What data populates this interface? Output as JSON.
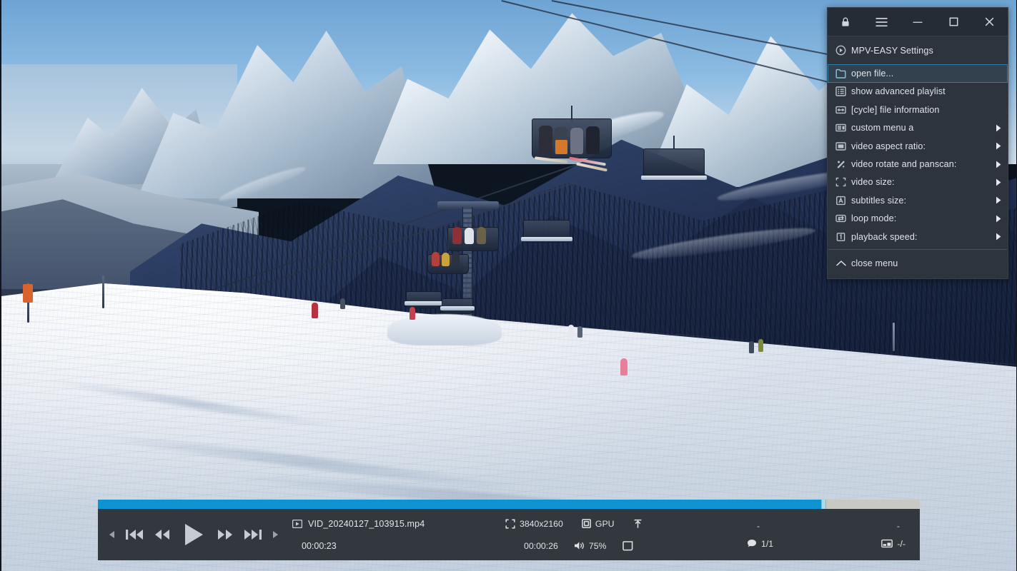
{
  "window": {
    "titlebar_buttons": [
      {
        "name": "lock",
        "icon": "lock-icon"
      },
      {
        "name": "menu",
        "icon": "hamburger-icon"
      },
      {
        "name": "minimize",
        "icon": "minimize-icon"
      },
      {
        "name": "maximize",
        "icon": "maximize-icon"
      },
      {
        "name": "close",
        "icon": "close-icon"
      }
    ]
  },
  "menu": {
    "accent_selected_border": "#2e7fa8",
    "background": "#2e343d",
    "items": [
      {
        "label": "MPV-EASY Settings",
        "icon": "play-circle-icon",
        "submenu": false,
        "selected": false
      },
      {
        "label": "open file...",
        "icon": "folder-icon",
        "submenu": false,
        "selected": true
      },
      {
        "label": "show advanced playlist",
        "icon": "list-icon",
        "submenu": false,
        "selected": false
      },
      {
        "label": "[cycle] file information",
        "icon": "arrows-horizontal-icon",
        "submenu": false,
        "selected": false
      },
      {
        "label": "custom menu a",
        "icon": "custom-menu-icon",
        "submenu": true,
        "selected": false
      },
      {
        "label": "video aspect ratio:",
        "icon": "aspect-ratio-icon",
        "submenu": true,
        "selected": false
      },
      {
        "label": "video rotate and panscan:",
        "icon": "rotate-icon",
        "submenu": true,
        "selected": false
      },
      {
        "label": "video size:",
        "icon": "resize-icon",
        "submenu": true,
        "selected": false
      },
      {
        "label": "subtitles size:",
        "icon": "subtitle-a-icon",
        "submenu": true,
        "selected": false
      },
      {
        "label": "loop mode:",
        "icon": "loop-icon",
        "submenu": true,
        "selected": false
      },
      {
        "label": "playback speed:",
        "icon": "speed-one-icon",
        "submenu": true,
        "selected": false
      }
    ],
    "close_item": {
      "label": "close menu",
      "icon": "chevron-up-icon"
    }
  },
  "osc": {
    "progress": {
      "percent": 88,
      "fill_color": "#0d92d2",
      "track_color": "#c9c9c4",
      "handle_color": "#a7dced"
    },
    "transport": [
      {
        "name": "prev-small",
        "icon": "triangle-left-small-icon"
      },
      {
        "name": "skip-backward",
        "icon": "skip-backward-icon"
      },
      {
        "name": "rewind",
        "icon": "rewind-icon"
      },
      {
        "name": "play-pause",
        "icon": "play-icon"
      },
      {
        "name": "fast-forward",
        "icon": "fast-forward-icon"
      },
      {
        "name": "skip-forward",
        "icon": "skip-forward-icon"
      },
      {
        "name": "next-small",
        "icon": "triangle-right-small-icon"
      }
    ],
    "file": {
      "icon": "video-file-icon",
      "name": "VID_20240127_103915.mp4",
      "elapsed": "00:00:23"
    },
    "status": {
      "resolution": {
        "icon": "fullscreen-corners-icon",
        "value": "3840x2160"
      },
      "decoder": {
        "icon": "chip-icon",
        "value": "GPU"
      },
      "upload": {
        "icon": "upload-arrow-icon",
        "value": ""
      },
      "duration": {
        "value": "00:00:26"
      },
      "volume": {
        "icon": "speaker-icon",
        "value": "75%"
      },
      "screenshot": {
        "icon": "screenshot-icon",
        "value": ""
      },
      "audio_track": {
        "icon": "comment-icon",
        "value": "1/1"
      },
      "subtitle_track": {
        "icon": "subtitle-box-icon",
        "value": "-/-"
      },
      "placeholder_left": "-",
      "placeholder_right": "-"
    }
  }
}
